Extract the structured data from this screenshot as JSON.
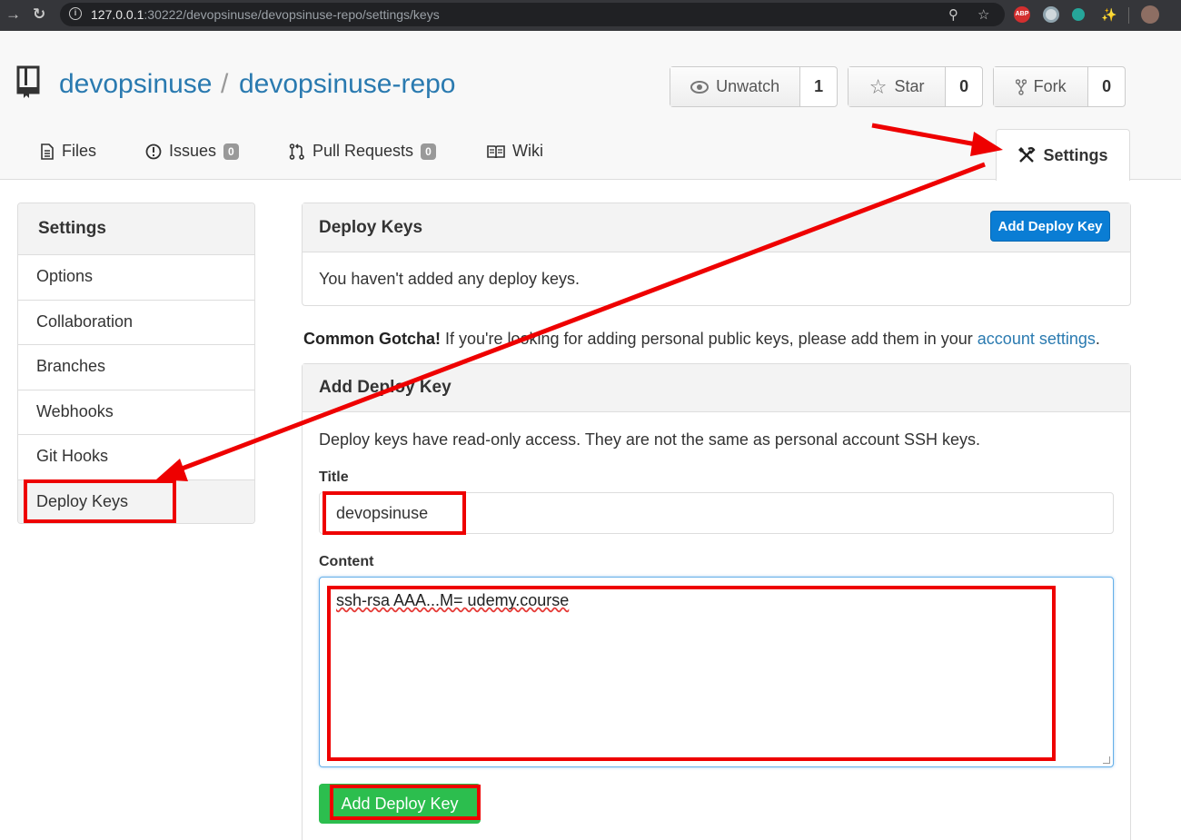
{
  "browser": {
    "url_host": "127.0.0.1",
    "url_rest": ":30222/devopsinuse/devopsinuse-repo/settings/keys",
    "back_icon": "arrow-right-icon",
    "reload_icon": "reload-icon",
    "ext_abp": "ABP"
  },
  "repo": {
    "owner": "devopsinuse",
    "separator": "/",
    "name": "devopsinuse-repo"
  },
  "actions": {
    "unwatch_label": "Unwatch",
    "unwatch_count": "1",
    "star_label": "Star",
    "star_count": "0",
    "fork_label": "Fork",
    "fork_count": "0"
  },
  "tabs": {
    "files": "Files",
    "issues": "Issues",
    "issues_count": "0",
    "pulls": "Pull Requests",
    "pulls_count": "0",
    "wiki": "Wiki",
    "settings": "Settings"
  },
  "sidebar": {
    "title": "Settings",
    "items": [
      "Options",
      "Collaboration",
      "Branches",
      "Webhooks",
      "Git Hooks",
      "Deploy Keys"
    ]
  },
  "deploy_keys": {
    "title": "Deploy Keys",
    "add_button": "Add Deploy Key",
    "empty_text": "You haven't added any deploy keys."
  },
  "gotcha": {
    "bold": "Common Gotcha!",
    "text": " If you're looking for adding personal public keys, please add them in your ",
    "link": "account settings",
    "end": "."
  },
  "add_key": {
    "title": "Add Deploy Key",
    "description": "Deploy keys have read-only access. They are not the same as personal account SSH keys.",
    "title_label": "Title",
    "title_value": "devopsinuse",
    "content_label": "Content",
    "content_value": "ssh-rsa AAA...M= udemy.course",
    "submit": "Add Deploy Key"
  },
  "colors": {
    "link": "#2a7ab0",
    "primary": "#0a7dd4",
    "success": "#2cbe4e",
    "annotation": "#ee0000"
  }
}
